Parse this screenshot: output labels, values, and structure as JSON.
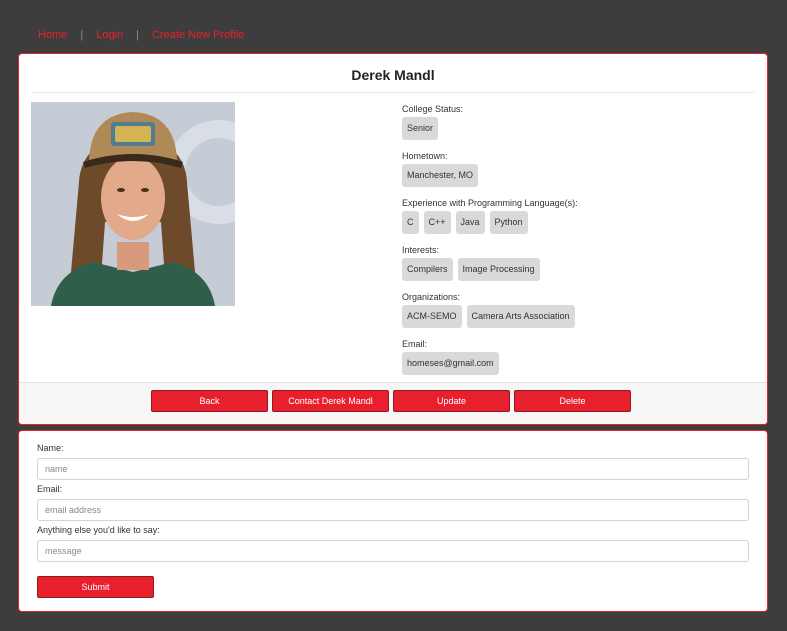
{
  "nav": {
    "items": [
      {
        "label": "Home"
      },
      {
        "label": "Login"
      },
      {
        "label": "Create New Profile"
      }
    ],
    "separator": "|"
  },
  "profile": {
    "name": "Derek Mandl",
    "college_status": {
      "label": "College Status:",
      "values": [
        "Senior"
      ]
    },
    "hometown": {
      "label": "Hometown:",
      "values": [
        "Manchester, MO"
      ]
    },
    "languages": {
      "label": "Experience with Programming Language(s):",
      "values": [
        "C",
        "C++",
        "Java",
        "Python"
      ]
    },
    "interests": {
      "label": "Interests:",
      "values": [
        "Compilers",
        "Image Processing"
      ]
    },
    "organizations": {
      "label": "Organizations:",
      "values": [
        "ACM-SEMO",
        "Camera Arts Association"
      ]
    },
    "email": {
      "label": "Email:",
      "values": [
        "homeses@gmail.com"
      ]
    }
  },
  "actions": {
    "back": "Back",
    "contact": "Contact Derek Mandl",
    "update": "Update",
    "delete": "Delete"
  },
  "contact_form": {
    "name_label": "Name:",
    "name_placeholder": "name",
    "email_label": "Email:",
    "email_placeholder": "email address",
    "message_label": "Anything else you'd like to say:",
    "message_placeholder": "message",
    "submit": "Submit"
  },
  "colors": {
    "accent": "#e8202e",
    "page_background": "#3d3d3d",
    "tag_background": "#d9d9d9"
  }
}
